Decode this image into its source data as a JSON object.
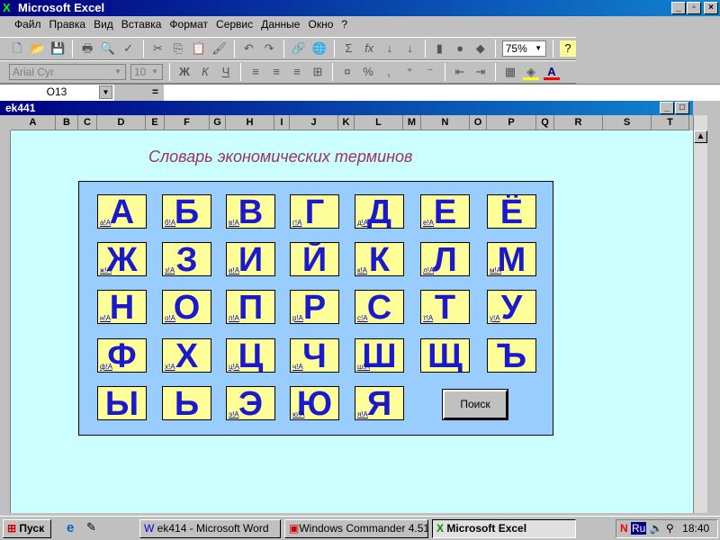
{
  "app": {
    "title": "Microsoft Excel"
  },
  "menu": [
    "Файл",
    "Правка",
    "Вид",
    "Вставка",
    "Формат",
    "Сервис",
    "Данные",
    "Окно",
    "?"
  ],
  "toolbar": {
    "zoom": "75%",
    "font": "Arial Cyr",
    "size": "10"
  },
  "formula_bar": {
    "name_box": "O13",
    "equals": "="
  },
  "workbook": {
    "title": "ek441"
  },
  "columns": [
    "A",
    "B",
    "C",
    "D",
    "E",
    "F",
    "G",
    "H",
    "I",
    "J",
    "K",
    "L",
    "M",
    "N",
    "O",
    "P",
    "Q",
    "R",
    "S",
    "T"
  ],
  "sheet": {
    "title": "Словарь экономических терминов",
    "search_button": "Поиск",
    "letters": [
      {
        "l": "А",
        "link": "а!А"
      },
      {
        "l": "Б",
        "link": "б!А"
      },
      {
        "l": "В",
        "link": "в!А"
      },
      {
        "l": "Г",
        "link": "г!А"
      },
      {
        "l": "Д",
        "link": "д!А"
      },
      {
        "l": "Е",
        "link": "е!А"
      },
      {
        "l": "Ё",
        "link": ""
      },
      {
        "l": "Ж",
        "link": "ж!А"
      },
      {
        "l": "З",
        "link": "з!А"
      },
      {
        "l": "И",
        "link": "и!А"
      },
      {
        "l": "Й",
        "link": ""
      },
      {
        "l": "К",
        "link": "к!А"
      },
      {
        "l": "Л",
        "link": "л!А"
      },
      {
        "l": "М",
        "link": "м!А"
      },
      {
        "l": "Н",
        "link": "н!А"
      },
      {
        "l": "О",
        "link": "о!А"
      },
      {
        "l": "П",
        "link": "п!А"
      },
      {
        "l": "Р",
        "link": "р!А"
      },
      {
        "l": "С",
        "link": "с!А"
      },
      {
        "l": "Т",
        "link": "т!А"
      },
      {
        "l": "У",
        "link": "у!А"
      },
      {
        "l": "Ф",
        "link": "ф!А"
      },
      {
        "l": "Х",
        "link": "х!А"
      },
      {
        "l": "Ц",
        "link": "ц!А"
      },
      {
        "l": "Ч",
        "link": "ч!А"
      },
      {
        "l": "Ш",
        "link": "ш!А"
      },
      {
        "l": "Щ",
        "link": ""
      },
      {
        "l": "Ъ",
        "link": ""
      },
      {
        "l": "Ы",
        "link": ""
      },
      {
        "l": "Ь",
        "link": ""
      },
      {
        "l": "Э",
        "link": "э!А"
      },
      {
        "l": "Ю",
        "link": "ю!А"
      },
      {
        "l": "Я",
        "link": "я!А"
      }
    ]
  },
  "taskbar": {
    "start": "Пуск",
    "tasks": [
      "ek414 - Microsoft Word",
      "Windows Commander 4.51...",
      "Microsoft Excel"
    ],
    "lang": "Ru",
    "clock": "18:40"
  }
}
